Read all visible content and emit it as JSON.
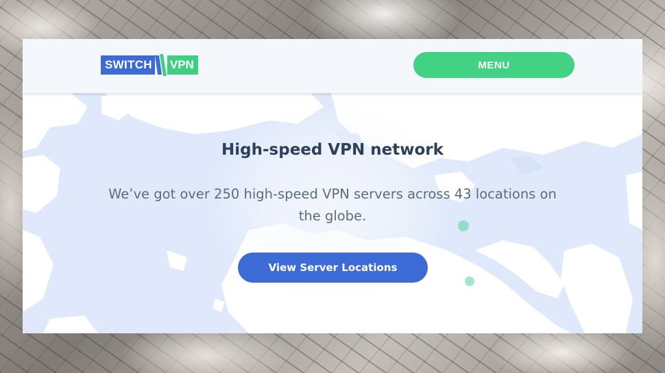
{
  "header": {
    "logo": {
      "word_left": "SWITCH",
      "word_right": "VPN"
    },
    "menu_label": "MENU"
  },
  "hero": {
    "title": "High-speed VPN network",
    "description": "We’ve got over 250 high-speed VPN servers across 43 locations on the globe.",
    "cta_label": "View Server Locations"
  },
  "colors": {
    "brand_blue": "#3d6bd6",
    "brand_green": "#43d184",
    "title_text": "#2e4059",
    "body_text": "#5c6b80",
    "map_water": "#dfe9fb",
    "map_land": "#ffffff"
  }
}
